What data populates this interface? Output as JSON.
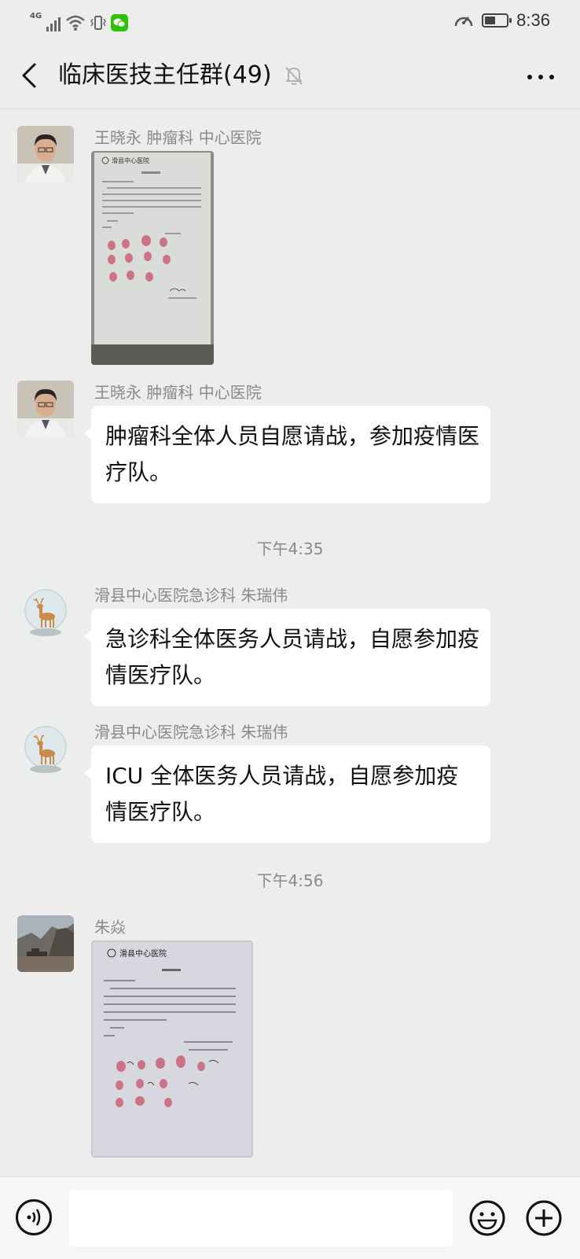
{
  "status_bar": {
    "network": "4G",
    "time": "8:36",
    "battery_level": 0.5
  },
  "header": {
    "title": "临床医技主任群(49)"
  },
  "messages": [
    {
      "sender": "王晓永  肿瘤科  中心医院",
      "type": "image",
      "image_header": "滑县中心医院"
    },
    {
      "sender": "王晓永  肿瘤科  中心医院",
      "type": "text",
      "text": "肿瘤科全体人员自愿请战，参加疫情医疗队。"
    },
    {
      "type": "timestamp",
      "text": "下午4:35"
    },
    {
      "sender": "滑县中心医院急诊科  朱瑞伟",
      "type": "text",
      "text": "急诊科全体医务人员请战，自愿参加疫情医疗队。"
    },
    {
      "sender": "滑县中心医院急诊科  朱瑞伟",
      "type": "text",
      "text": "ICU 全体医务人员请战，自愿参加疫情医疗队。"
    },
    {
      "type": "timestamp",
      "text": "下午4:56"
    },
    {
      "sender": "朱焱",
      "type": "image",
      "image_header": "滑县中心医院"
    }
  ],
  "input_bar": {
    "placeholder": ""
  },
  "colors": {
    "background": "#ededed",
    "bubble": "#ffffff",
    "wechat_green": "#2dc100",
    "fingerprint_red": "#c8506a"
  }
}
